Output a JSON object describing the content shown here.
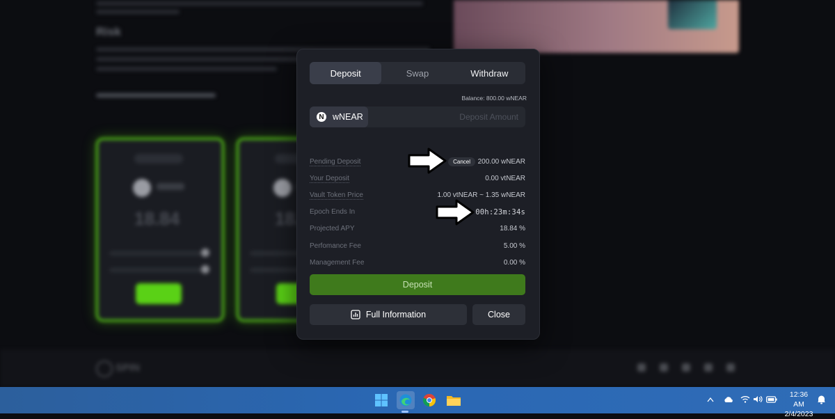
{
  "modal": {
    "tabs": [
      {
        "label": "Deposit",
        "active": true
      },
      {
        "label": "Swap",
        "active": false
      },
      {
        "label": "Withdraw",
        "active": false
      }
    ],
    "balance": "Balance: 800.00 wNEAR",
    "token": {
      "icon_letter": "N",
      "name": "wNEAR"
    },
    "amount_placeholder": "Deposit Amount",
    "cancel_label": "Cancel",
    "rows": {
      "pending_deposit": {
        "label": "Pending Deposit",
        "value": "200.00 wNEAR"
      },
      "your_deposit": {
        "label": "Your Deposit",
        "value": "0.00 vtNEAR"
      },
      "vault_token_price": {
        "label": "Vault Token Price",
        "value": "1.00 vtNEAR ~ 1.35 wNEAR"
      },
      "epoch_ends_in": {
        "label": "Epoch Ends In",
        "value": "00h:23m:34s"
      },
      "projected_apy": {
        "label": "Projected APY",
        "value": "18.84 %"
      },
      "performance_fee": {
        "label": "Perfomance Fee",
        "value": "5.00 %"
      },
      "management_fee": {
        "label": "Management Fee",
        "value": "0.00 %"
      }
    },
    "deposit_button": "Deposit",
    "full_info_button": "Full Information",
    "close_button": "Close"
  },
  "background": {
    "risk_heading": "Risk",
    "card_value": "18.84",
    "footer_logo": "SPIN"
  },
  "taskbar": {
    "time": "12:36 AM",
    "date": "2/4/2023"
  },
  "colors": {
    "accent_green": "#3f7a1c",
    "card_glow": "#5ad116",
    "modal_bg": "#1d1f26"
  }
}
